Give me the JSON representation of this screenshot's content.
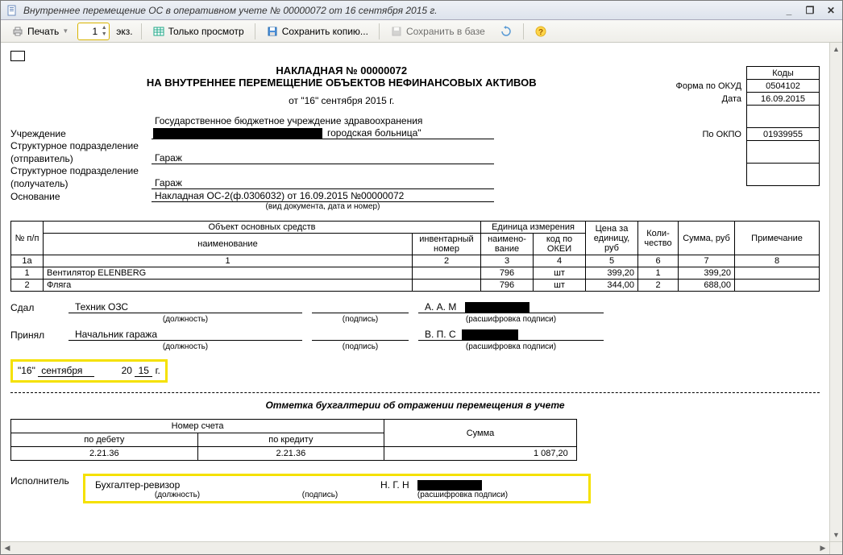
{
  "window": {
    "title": "Внутреннее перемещение ОС в оперативном учете № 00000072 от 16 сентября 2015 г."
  },
  "toolbar": {
    "print": "Печать",
    "copies_value": "1",
    "copies_suffix": "экз.",
    "preview_only": "Только просмотр",
    "save_copy": "Сохранить копию...",
    "save_db": "Сохранить в базе"
  },
  "doc": {
    "title_line1": "НАКЛАДНАЯ № 00000072",
    "title_line2": "НА ВНУТРЕННЕЕ ПЕРЕМЕЩЕНИЕ ОБЪЕКТОВ НЕФИНАНСОВЫХ АКТИВОВ",
    "date_line": "от \"16\" сентября 2015 г.",
    "codes": {
      "header": "Коды",
      "okud_label": "Форма по ОКУД",
      "okud": "0504102",
      "date_label": "Дата",
      "date": "16.09.2015",
      "okpo_label": "По ОКПО",
      "okpo": "01939955"
    },
    "org_label": "Учреждение",
    "org_value": "Государственное бюджетное учреждение здравоохранения",
    "org_value2": "городская больница\"",
    "sender_label1": "Структурное подразделение",
    "sender_label2": "(отправитель)",
    "sender_value": "Гараж",
    "receiver_label1": "Структурное подразделение",
    "receiver_label2": "(получатель)",
    "receiver_value": "Гараж",
    "basis_label": "Основание",
    "basis_value": "Накладная ОС-2(ф.0306032) от 16.09.2015 №00000072",
    "basis_caption": "(вид документа, дата и номер)"
  },
  "table": {
    "h_npp": "№ п/п",
    "h_obj": "Объект основных средств",
    "h_name": "наименование",
    "h_inv": "инвентарный номер",
    "h_unit": "Единица измерения",
    "h_unit_name": "наимено-вание",
    "h_unit_code": "код по ОКЕИ",
    "h_price": "Цена за единицу, руб",
    "h_qty": "Коли-чество",
    "h_sum": "Сумма, руб",
    "h_note": "Примечание",
    "num_row": [
      "1а",
      "1",
      "2",
      "3",
      "4",
      "5",
      "6",
      "7",
      "8"
    ],
    "rows": [
      {
        "n": "1",
        "name": "Вентилятор ELENBERG",
        "inv": "",
        "uname": "796",
        "ucode": "шт",
        "price": "399,20",
        "qty": "1",
        "sum": "399,20",
        "note": ""
      },
      {
        "n": "2",
        "name": "Фляга",
        "inv": "",
        "uname": "796",
        "ucode": "шт",
        "price": "344,00",
        "qty": "2",
        "sum": "688,00",
        "note": ""
      }
    ]
  },
  "sign": {
    "gave_label": "Сдал",
    "gave_pos": "Техник ОЗС",
    "gave_name_prefix": "А. А. М",
    "got_label": "Принял",
    "got_pos": "Начальник гаража",
    "got_name_prefix": "В. П. С",
    "pos_caption": "(должность)",
    "sig_caption": "(подпись)",
    "name_caption": "(расшифровка подписи)"
  },
  "footer_date": {
    "day": "\"16\"",
    "month": "сентября",
    "year_prefix": "20",
    "year": "15",
    "year_suffix": "г."
  },
  "accounting": {
    "title": "Отметка бухгалтерии об отражении перемещения в учете",
    "h_account": "Номер счета",
    "h_debit": "по дебету",
    "h_credit": "по кредиту",
    "h_sum": "Сумма",
    "debit": "2.21.36",
    "credit": "2.21.36",
    "sum": "1 087,20"
  },
  "executor": {
    "label": "Исполнитель",
    "pos": "Бухгалтер-ревизор",
    "name_prefix": "Н. Г. Н",
    "pos_caption": "(должность)",
    "sig_caption": "(подпись)",
    "name_caption": "(расшифровка подписи)"
  }
}
